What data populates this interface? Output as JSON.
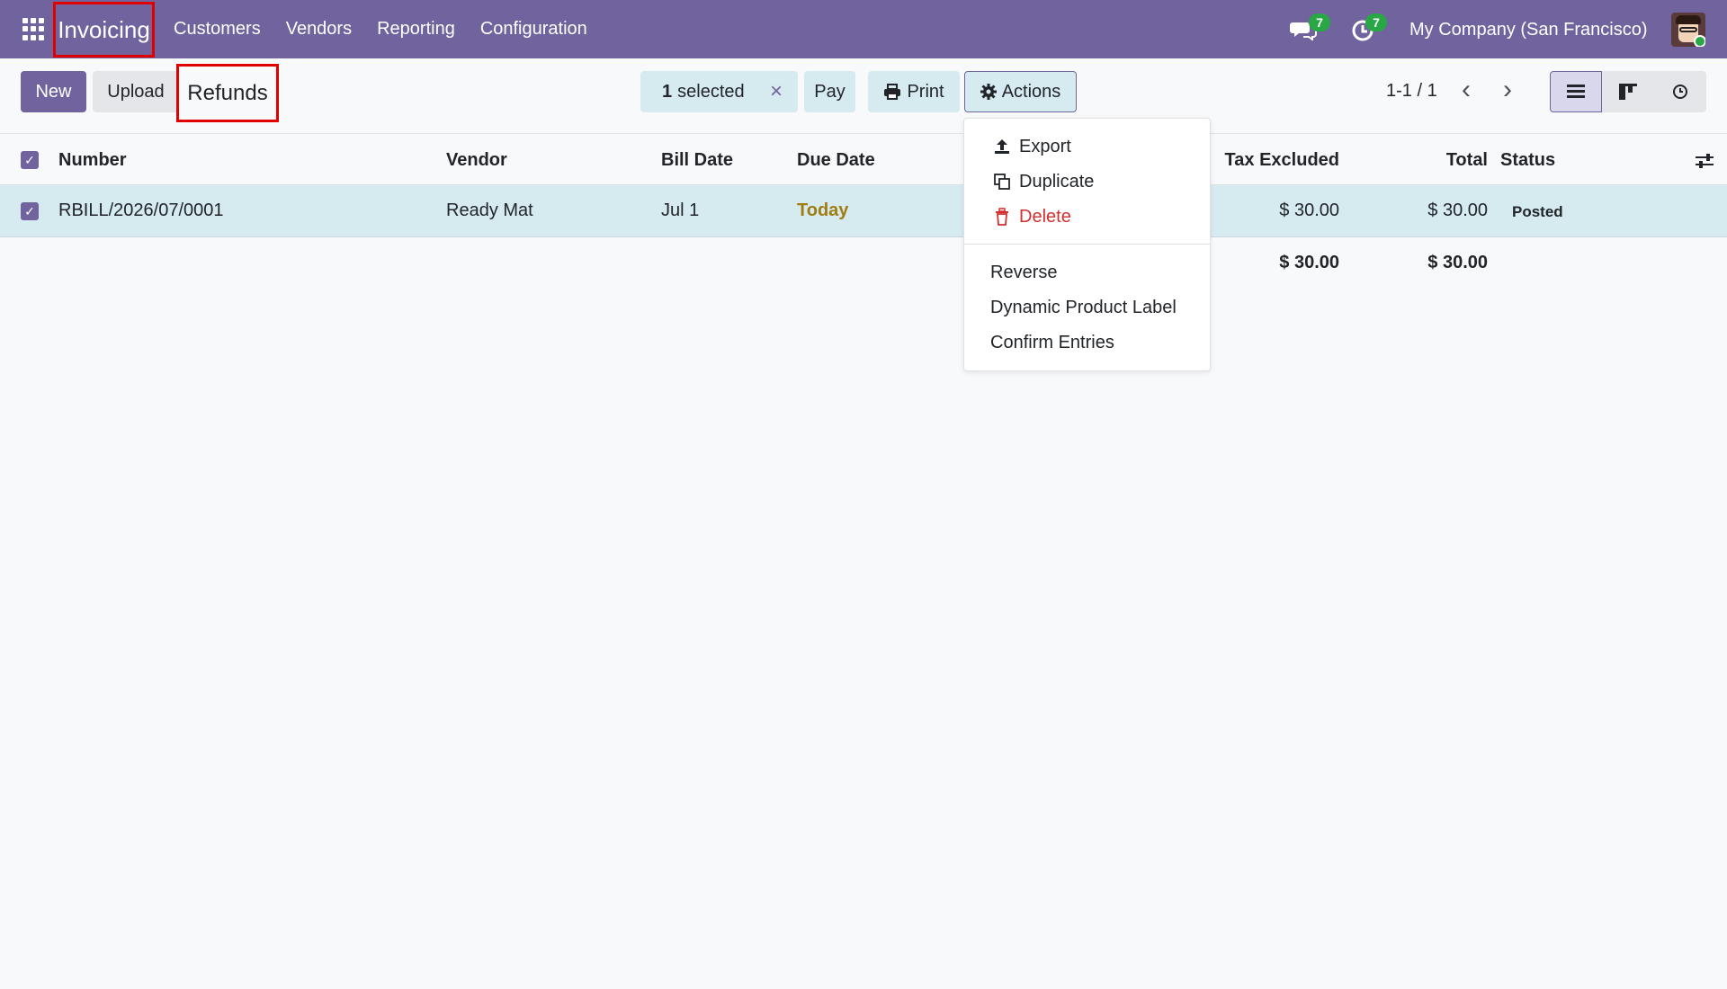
{
  "navbar": {
    "app_name": "Invoicing",
    "menu": [
      "Customers",
      "Vendors",
      "Reporting",
      "Configuration"
    ],
    "chat_count": "7",
    "activity_count": "7",
    "company": "My Company (San Francisco)"
  },
  "control_panel": {
    "new_label": "New",
    "upload_label": "Upload",
    "title": "Refunds",
    "selected_count": "1",
    "selected_label": "selected",
    "pay_label": "Pay",
    "print_label": "Print",
    "actions_label": "Actions",
    "pager": "1-1 / 1"
  },
  "list": {
    "columns": {
      "number": "Number",
      "vendor": "Vendor",
      "bill_date": "Bill Date",
      "due_date": "Due Date",
      "tax_excluded": "Tax Excluded",
      "total": "Total",
      "status": "Status"
    },
    "rows": [
      {
        "number": "RBILL/2026/07/0001",
        "vendor": "Ready Mat",
        "bill_date": "Jul 1",
        "due_date": "Today",
        "tax_excluded": "$ 30.00",
        "total": "$ 30.00",
        "status": "Posted"
      }
    ],
    "totals": {
      "tax_excluded": "$ 30.00",
      "total": "$ 30.00"
    }
  },
  "actions_menu": {
    "items": [
      "Export",
      "Duplicate",
      "Delete",
      "Reverse",
      "Dynamic Product Label",
      "Confirm Entries"
    ]
  },
  "colors": {
    "brand": "#71639e",
    "selected_row": "#d6ebf0",
    "highlight_border": "#e00000",
    "badge": "#28a745",
    "danger": "#d32f2f",
    "due_today": "#a07d12"
  }
}
